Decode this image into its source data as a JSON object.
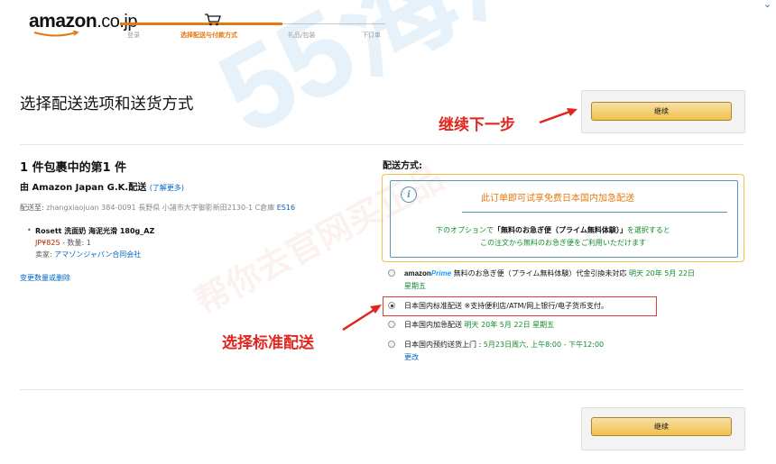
{
  "header": {
    "logo_text": "amazon",
    "logo_suffix": ".co.jp",
    "steps": [
      "登录",
      "选择配送与付款方式",
      "礼品/包装",
      "下订单"
    ],
    "edge_icon": "chevron-down-icon"
  },
  "page": {
    "title": "选择配送选项和送货方式",
    "continue_label": "继续"
  },
  "shipment": {
    "title": "1 件包裹中的第1 件",
    "ship_by": "由 Amazon Japan G.K.配送",
    "learn_more": "(了解更多)",
    "address_label": "配送至:",
    "address_value": "zhangxiaojuan 384-0091 長野県 小諸市大字御影新田2130-1 C倉庫",
    "address_code": "ES16",
    "item": {
      "name": "Rosett 洗面奶 海泥光滑 180g_AZ",
      "price": "JP¥825",
      "qty_label": "- 数量:",
      "qty": "1",
      "seller_label": "卖家:",
      "seller": "アマゾンジャパン合同会社"
    },
    "change_qty": "变更数量或删除"
  },
  "delivery": {
    "label": "配送方式:",
    "prime_box": {
      "title": "此订单即可试享免费日本国内加急配送",
      "desc_prefix": "下のオプションで",
      "desc_bold": "「無料のお急ぎ便（プライム無料体験）」",
      "desc_suffix": "を選択すると",
      "desc_line2": "この注文から無料のお急ぎ便をご利用いただけます"
    },
    "options": [
      {
        "logo_a": "amazon",
        "logo_b": "Prime",
        "text": "無料のお急ぎ便（プライム無料体験）代金引換未対応",
        "date": "明天 20年 5月 22日",
        "date2": "星期五",
        "checked": false
      },
      {
        "text": "日本国内标准配送 ※支持便利店/ATM/网上银行/电子货币支付。",
        "checked": true
      },
      {
        "text": "日本国内加急配送",
        "date": "明天 20年 5月 22日 星期五",
        "checked": false
      },
      {
        "text": "日本国内预约送货上门 :",
        "date": "5月23日周六, 上午8:00 - 下午12:00",
        "checked": false
      }
    ],
    "change": "更改"
  },
  "annotations": {
    "continue_hint": "继续下一步",
    "select_hint": "选择标准配送"
  },
  "watermark": {
    "text": "55海淘",
    "sub": "帮你去官网买正品"
  },
  "colors": {
    "accent": "#e47911",
    "link": "#0066c0",
    "green": "#138c2a",
    "button": "#f0c14b",
    "annotation": "#e0261f"
  }
}
